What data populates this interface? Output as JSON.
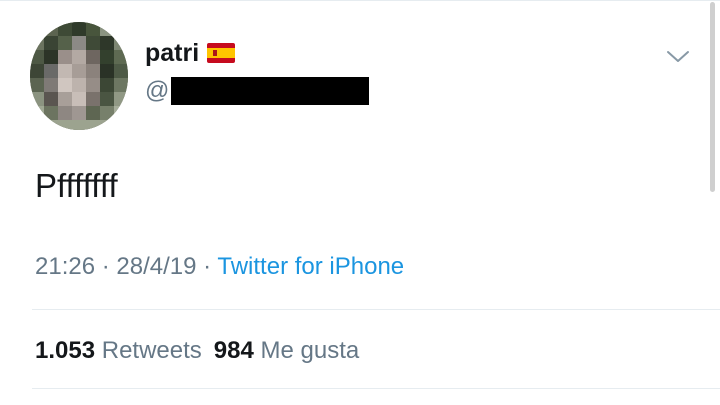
{
  "tweet": {
    "display_name": "patri",
    "flag_icon": "spain-flag-icon",
    "handle_prefix": "@",
    "text": "Pfffffff",
    "time": "21:26",
    "separator": "·",
    "date": "28/4/19",
    "source": "Twitter for iPhone",
    "retweet_count": "1.053",
    "retweet_label": "Retweets",
    "like_count": "984",
    "like_label": "Me gusta",
    "caret_icon": "chevron-down-icon"
  },
  "colors": {
    "primary_text": "#14171a",
    "secondary_text": "#657786",
    "link": "#1b95e0",
    "divider": "#e6ecf0"
  }
}
